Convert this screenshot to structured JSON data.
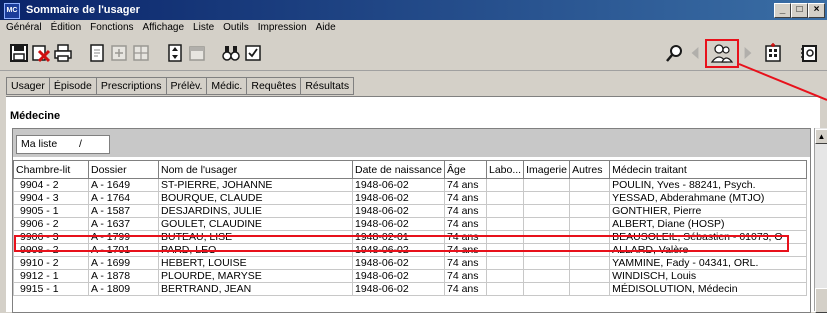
{
  "window": {
    "title": "Sommaire de l'usager",
    "app_badge": "MC",
    "controls": [
      "_",
      "□",
      "×"
    ]
  },
  "menu": [
    "Général",
    "Édition",
    "Fonctions",
    "Affichage",
    "Liste",
    "Outils",
    "Impression",
    "Aide"
  ],
  "toolbar_icons": [
    "save-icon",
    "delete-icon",
    "print-icon",
    "document-icon",
    "calculator-icon",
    "grid-icon",
    "sort-icon",
    "calendar-icon",
    "binoculars-icon",
    "checklist-icon",
    "search-icon",
    "previous-icon",
    "patient-icon",
    "next-icon",
    "hospital-icon",
    "agenda-icon"
  ],
  "tabs": [
    "Usager",
    "Épisode",
    "Prescriptions",
    "Prélèv.",
    "Médic.",
    "Requêtes",
    "Résultats"
  ],
  "section_title": "Médecine",
  "list_selector": {
    "value": "Ma liste",
    "arrow": "/"
  },
  "columns": [
    "Chambre-lit",
    "Dossier",
    "Nom de l'usager",
    "Date de naissance",
    "Âge",
    "Labo...",
    "Imagerie",
    "Autres",
    "Médecin traitant"
  ],
  "rows": [
    [
      "9904 - 2",
      "A - 1649",
      "ST-PIERRE, JOHANNE",
      "1948-06-02",
      "74 ans",
      "",
      "",
      "",
      "POULIN, Yves - 88241, Psych."
    ],
    [
      "9904 - 3",
      "A - 1764",
      "BOURQUE, CLAUDE",
      "1948-06-02",
      "74 ans",
      "",
      "",
      "",
      "YESSAD, Abderahmane (MTJO)"
    ],
    [
      "9905 - 1",
      "A - 1587",
      "DESJARDINS, JULIE",
      "1948-06-02",
      "74 ans",
      "",
      "",
      "",
      "GONTHIER, Pierre"
    ],
    [
      "9906 - 2",
      "A - 1637",
      "GOULET, CLAUDINE",
      "1948-06-02",
      "74 ans",
      "",
      "",
      "",
      "ALBERT, Diane (HOSP)"
    ],
    [
      "9906 - 3",
      "A - 1799",
      "BUTEAU, LISE",
      "1948-02-01",
      "74 ans",
      "",
      "",
      "",
      "BEAUSOLEIL, Sébastien - 01073, O"
    ],
    [
      "9908 - 2",
      "A - 1701",
      "PARD, LEO",
      "1948-06-02",
      "74 ans",
      "",
      "",
      "",
      "ALLARD, Valère"
    ],
    [
      "9910 - 2",
      "A - 1699",
      "HEBERT, LOUISE",
      "1948-06-02",
      "74 ans",
      "",
      "",
      "",
      "YAMMINE, Fady - 04341, ORL."
    ],
    [
      "9912 - 1",
      "A - 1878",
      "PLOURDE, MARYSE",
      "1948-06-02",
      "74 ans",
      "",
      "",
      "",
      "WINDISCH, Louis"
    ],
    [
      "9915 - 1",
      "A - 1809",
      "BERTRAND, JEAN",
      "1948-06-02",
      "74 ans",
      "",
      "",
      "",
      "MÉDISOLUTION, Médecin"
    ]
  ],
  "highlighted_row": 4,
  "colors": {
    "highlight": "#e8111b",
    "titlebar": "#0a246a",
    "chrome": "#d4d0c8"
  }
}
